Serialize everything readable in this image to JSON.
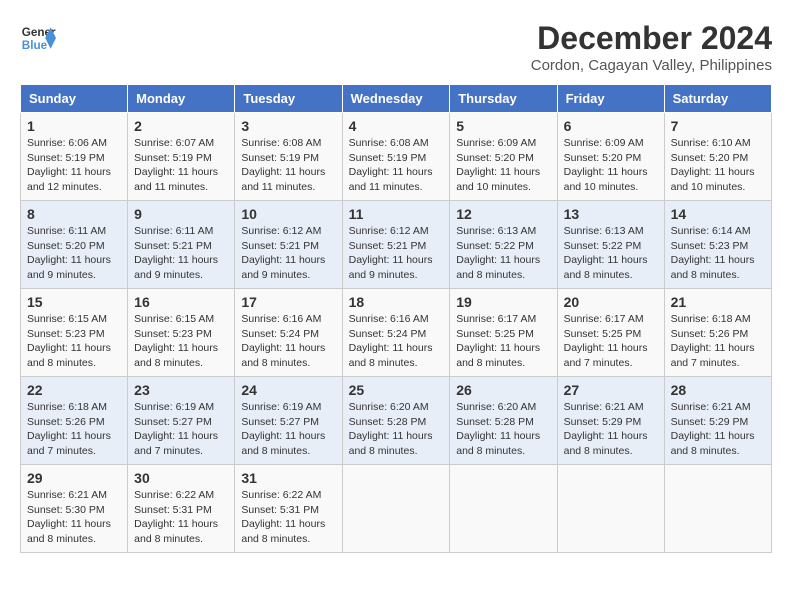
{
  "header": {
    "logo_line1": "General",
    "logo_line2": "Blue",
    "month": "December 2024",
    "location": "Cordon, Cagayan Valley, Philippines"
  },
  "weekdays": [
    "Sunday",
    "Monday",
    "Tuesday",
    "Wednesday",
    "Thursday",
    "Friday",
    "Saturday"
  ],
  "weeks": [
    [
      {
        "day": "1",
        "sunrise": "6:06 AM",
        "sunset": "5:19 PM",
        "daylight": "11 hours and 12 minutes."
      },
      {
        "day": "2",
        "sunrise": "6:07 AM",
        "sunset": "5:19 PM",
        "daylight": "11 hours and 11 minutes."
      },
      {
        "day": "3",
        "sunrise": "6:08 AM",
        "sunset": "5:19 PM",
        "daylight": "11 hours and 11 minutes."
      },
      {
        "day": "4",
        "sunrise": "6:08 AM",
        "sunset": "5:19 PM",
        "daylight": "11 hours and 11 minutes."
      },
      {
        "day": "5",
        "sunrise": "6:09 AM",
        "sunset": "5:20 PM",
        "daylight": "11 hours and 10 minutes."
      },
      {
        "day": "6",
        "sunrise": "6:09 AM",
        "sunset": "5:20 PM",
        "daylight": "11 hours and 10 minutes."
      },
      {
        "day": "7",
        "sunrise": "6:10 AM",
        "sunset": "5:20 PM",
        "daylight": "11 hours and 10 minutes."
      }
    ],
    [
      {
        "day": "8",
        "sunrise": "6:11 AM",
        "sunset": "5:20 PM",
        "daylight": "11 hours and 9 minutes."
      },
      {
        "day": "9",
        "sunrise": "6:11 AM",
        "sunset": "5:21 PM",
        "daylight": "11 hours and 9 minutes."
      },
      {
        "day": "10",
        "sunrise": "6:12 AM",
        "sunset": "5:21 PM",
        "daylight": "11 hours and 9 minutes."
      },
      {
        "day": "11",
        "sunrise": "6:12 AM",
        "sunset": "5:21 PM",
        "daylight": "11 hours and 9 minutes."
      },
      {
        "day": "12",
        "sunrise": "6:13 AM",
        "sunset": "5:22 PM",
        "daylight": "11 hours and 8 minutes."
      },
      {
        "day": "13",
        "sunrise": "6:13 AM",
        "sunset": "5:22 PM",
        "daylight": "11 hours and 8 minutes."
      },
      {
        "day": "14",
        "sunrise": "6:14 AM",
        "sunset": "5:23 PM",
        "daylight": "11 hours and 8 minutes."
      }
    ],
    [
      {
        "day": "15",
        "sunrise": "6:15 AM",
        "sunset": "5:23 PM",
        "daylight": "11 hours and 8 minutes."
      },
      {
        "day": "16",
        "sunrise": "6:15 AM",
        "sunset": "5:23 PM",
        "daylight": "11 hours and 8 minutes."
      },
      {
        "day": "17",
        "sunrise": "6:16 AM",
        "sunset": "5:24 PM",
        "daylight": "11 hours and 8 minutes."
      },
      {
        "day": "18",
        "sunrise": "6:16 AM",
        "sunset": "5:24 PM",
        "daylight": "11 hours and 8 minutes."
      },
      {
        "day": "19",
        "sunrise": "6:17 AM",
        "sunset": "5:25 PM",
        "daylight": "11 hours and 8 minutes."
      },
      {
        "day": "20",
        "sunrise": "6:17 AM",
        "sunset": "5:25 PM",
        "daylight": "11 hours and 7 minutes."
      },
      {
        "day": "21",
        "sunrise": "6:18 AM",
        "sunset": "5:26 PM",
        "daylight": "11 hours and 7 minutes."
      }
    ],
    [
      {
        "day": "22",
        "sunrise": "6:18 AM",
        "sunset": "5:26 PM",
        "daylight": "11 hours and 7 minutes."
      },
      {
        "day": "23",
        "sunrise": "6:19 AM",
        "sunset": "5:27 PM",
        "daylight": "11 hours and 7 minutes."
      },
      {
        "day": "24",
        "sunrise": "6:19 AM",
        "sunset": "5:27 PM",
        "daylight": "11 hours and 8 minutes."
      },
      {
        "day": "25",
        "sunrise": "6:20 AM",
        "sunset": "5:28 PM",
        "daylight": "11 hours and 8 minutes."
      },
      {
        "day": "26",
        "sunrise": "6:20 AM",
        "sunset": "5:28 PM",
        "daylight": "11 hours and 8 minutes."
      },
      {
        "day": "27",
        "sunrise": "6:21 AM",
        "sunset": "5:29 PM",
        "daylight": "11 hours and 8 minutes."
      },
      {
        "day": "28",
        "sunrise": "6:21 AM",
        "sunset": "5:29 PM",
        "daylight": "11 hours and 8 minutes."
      }
    ],
    [
      {
        "day": "29",
        "sunrise": "6:21 AM",
        "sunset": "5:30 PM",
        "daylight": "11 hours and 8 minutes."
      },
      {
        "day": "30",
        "sunrise": "6:22 AM",
        "sunset": "5:31 PM",
        "daylight": "11 hours and 8 minutes."
      },
      {
        "day": "31",
        "sunrise": "6:22 AM",
        "sunset": "5:31 PM",
        "daylight": "11 hours and 8 minutes."
      },
      null,
      null,
      null,
      null
    ]
  ]
}
